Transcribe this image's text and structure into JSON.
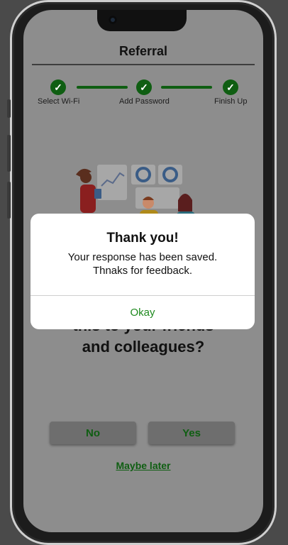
{
  "header": {
    "title": "Referral"
  },
  "steps": [
    {
      "label": "Select Wi-Fi"
    },
    {
      "label": "Add Password"
    },
    {
      "label": "Finish Up"
    }
  ],
  "question": {
    "line1": "this to your friends",
    "line2": "and colleagues?"
  },
  "actions": {
    "no_label": "No",
    "yes_label": "Yes",
    "later_label": "Maybe later"
  },
  "dialog": {
    "title": "Thank you!",
    "message_line1": "Your response has been saved.",
    "message_line2": "Thnaks for feedback.",
    "ok_label": "Okay"
  },
  "colors": {
    "accent_green": "#0f5e12",
    "overlay_gray": "#8d8d8d",
    "dialog_bg": "#ffffff"
  }
}
